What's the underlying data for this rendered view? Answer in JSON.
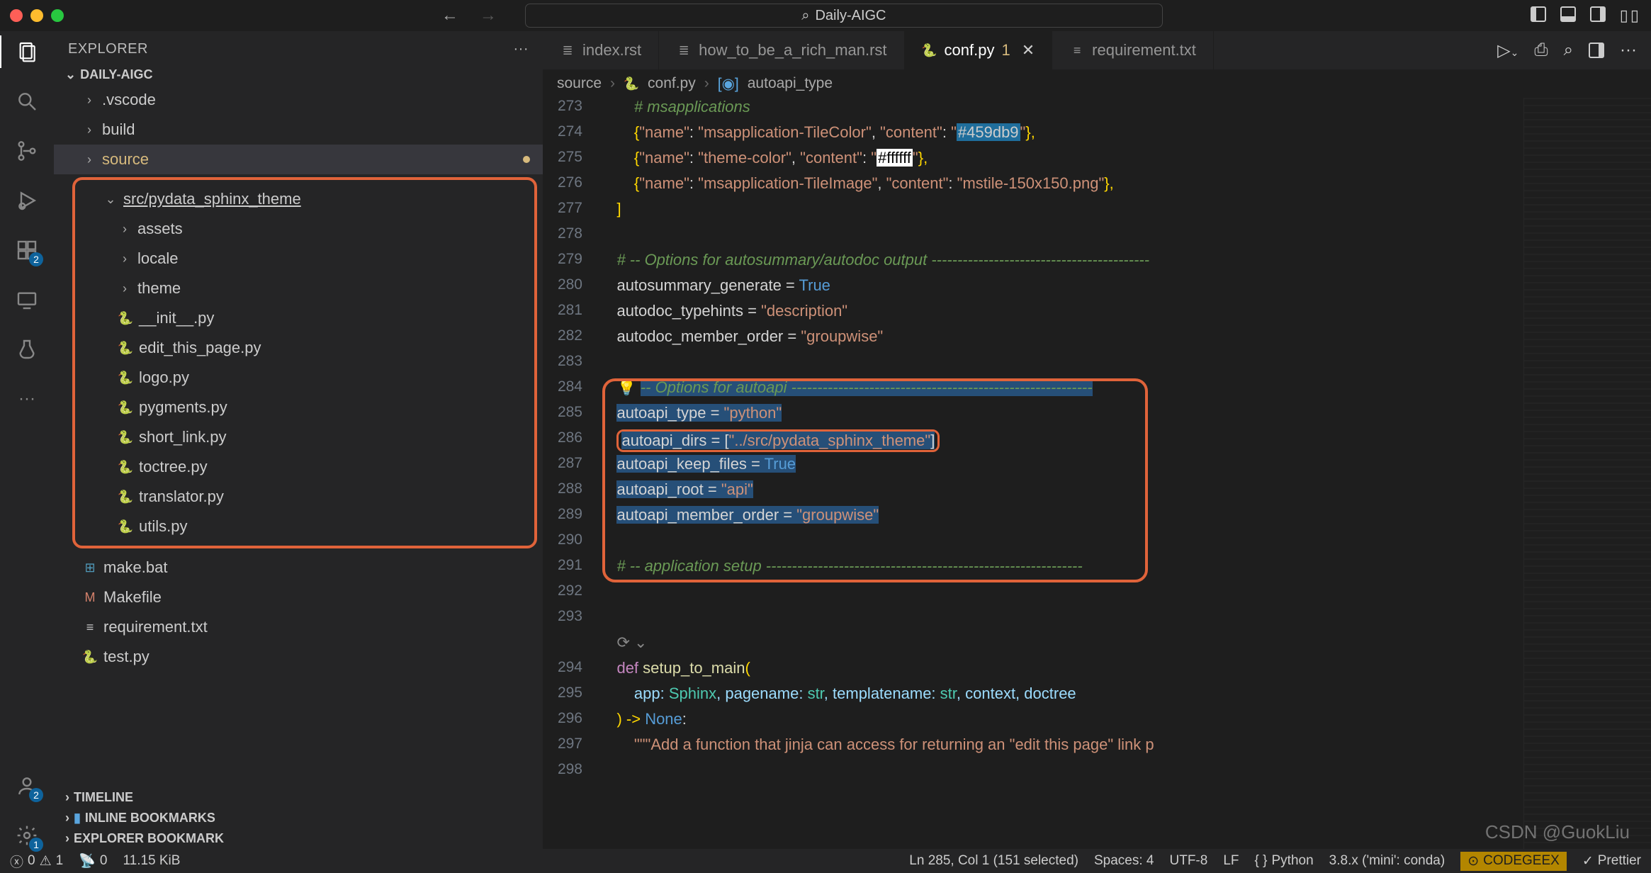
{
  "title_search": "Daily-AIGC",
  "explorer": {
    "title": "EXPLORER",
    "project": "DAILY-AIGC",
    "sections": {
      "timeline": "TIMELINE",
      "inline_bookmarks": "INLINE BOOKMARKS",
      "explorer_bookmark": "EXPLORER BOOKMARK"
    },
    "tree": {
      "vscode": ".vscode",
      "build": "build",
      "source": "source",
      "src_folder": "src/pydata_sphinx_theme",
      "assets": "assets",
      "locale": "locale",
      "theme": "theme",
      "files": {
        "init": "__init__.py",
        "edit": "edit_this_page.py",
        "logo": "logo.py",
        "pygments": "pygments.py",
        "short_link": "short_link.py",
        "toctree": "toctree.py",
        "translator": "translator.py",
        "utils": "utils.py"
      },
      "makebat": "make.bat",
      "makefile": "Makefile",
      "requirement": "requirement.txt",
      "testpy": "test.py"
    }
  },
  "tabs": {
    "t1": "index.rst",
    "t2": "how_to_be_a_rich_man.rst",
    "t3": "conf.py",
    "t3_mod": "1",
    "t4": "requirement.txt"
  },
  "breadcrumb": {
    "p1": "source",
    "p2": "conf.py",
    "p3": "autoapi_type"
  },
  "lines": {
    "273": "        # msapplications",
    "274a": "        {",
    "274n": "\"name\"",
    "274b": ": ",
    "274v1": "\"msapplication-TileColor\"",
    "274c": ", ",
    "274k": "\"content\"",
    "274d": ": ",
    "274v2": "\"",
    "274hl": "#459db9",
    "274v3": "\"",
    "274e": "},",
    "275a": "        {",
    "275n": "\"name\"",
    "275b": ": ",
    "275v1": "\"theme-color\"",
    "275c": ", ",
    "275k": "\"content\"",
    "275d": ": ",
    "275v2": "\"",
    "275hl": "#ffffff",
    "275v3": "\"",
    "275e": "},",
    "276a": "        {",
    "276n": "\"name\"",
    "276b": ": ",
    "276v1": "\"msapplication-TileImage\"",
    "276c": ", ",
    "276k": "\"content\"",
    "276d": ": ",
    "276v2": "\"mstile-150x150.png\"",
    "276e": "},",
    "277": "    ]",
    "279": "# -- Options for autosummary/autodoc output ------------------------------------------",
    "280a": "autosummary_generate",
    "280b": " = ",
    "280c": "True",
    "281a": "autodoc_typehints",
    "281b": " = ",
    "281c": "\"description\"",
    "282a": "autodoc_member_order",
    "282b": " = ",
    "282c": "\"groupwise\"",
    "284": "-- Options for autoapi ----------------------------------------------------------",
    "285a": "autoapi_type",
    "285b": " = ",
    "285c": "\"python\"",
    "286a": "autoapi_dirs",
    "286b": " = [",
    "286c": "\"../src/pydata_sphinx_theme\"",
    "286d": "]",
    "287a": "autoapi_keep_files",
    "287b": " = ",
    "287c": "True",
    "288a": "autoapi_root",
    "288b": " = ",
    "288c": "\"api\"",
    "289a": "autoapi_member_order",
    "289b": " = ",
    "289c": "\"groupwise\"",
    "291": "# -- application setup -------------------------------------------------------------",
    "294a": "def",
    "294b": " setup_to_main",
    "294c": "(",
    "295": "    app: ",
    "295t": "Sphinx",
    "295r": ", pagename: ",
    "295s": "str",
    "295r2": ", templatename: ",
    "295s2": "str",
    "295r3": ", context, doctree",
    "296a": ") -> ",
    "296b": "None",
    "296c": ":",
    "297": "    \"\"\"Add a function that jinja can access for returning an \"edit this page\" link p"
  },
  "statusbar": {
    "errors": "0",
    "warnings": "1",
    "radio": "0",
    "size": "11.15 KiB",
    "pos": "Ln 285, Col 1 (151 selected)",
    "spaces": "Spaces: 4",
    "enc": "UTF-8",
    "eol": "LF",
    "lang": "Python",
    "env": "3.8.x ('mini': conda)",
    "codegeex": "CODEGEEX",
    "prettier": "Prettier"
  },
  "watermark": "CSDN @GuokLiu",
  "badges": {
    "ext": "2",
    "acc": "2",
    "gear": "1"
  }
}
